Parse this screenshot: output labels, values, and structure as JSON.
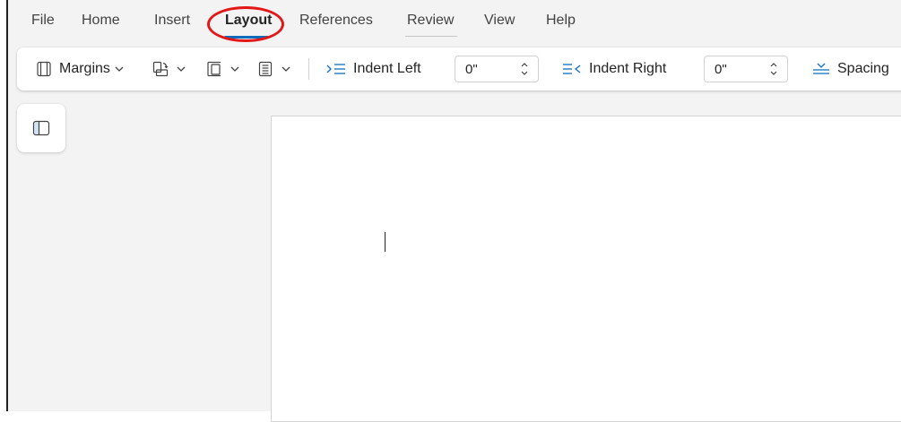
{
  "tabs": [
    {
      "label": "File"
    },
    {
      "label": "Home"
    },
    {
      "label": "Insert"
    },
    {
      "label": "Layout",
      "active": true
    },
    {
      "label": "References"
    },
    {
      "label": "Review"
    },
    {
      "label": "View"
    },
    {
      "label": "Help"
    }
  ],
  "ribbon": {
    "margins_label": "Margins",
    "indent_left_label": "Indent Left",
    "indent_left_value": "0\"",
    "indent_right_label": "Indent Right",
    "indent_right_value": "0\"",
    "spacing_label": "Spacing"
  },
  "icons": {
    "margins": "margins-icon",
    "orientation": "orientation-icon",
    "size": "page-size-icon",
    "columns": "columns-icon",
    "indent_left": "indent-left-icon",
    "indent_right": "indent-right-icon",
    "spacing": "spacing-before-icon",
    "side_panel": "navigation-pane-icon"
  },
  "colors": {
    "accent": "#0f6cbd",
    "highlight": "#e31717",
    "app_background": "#f3f3f3"
  }
}
